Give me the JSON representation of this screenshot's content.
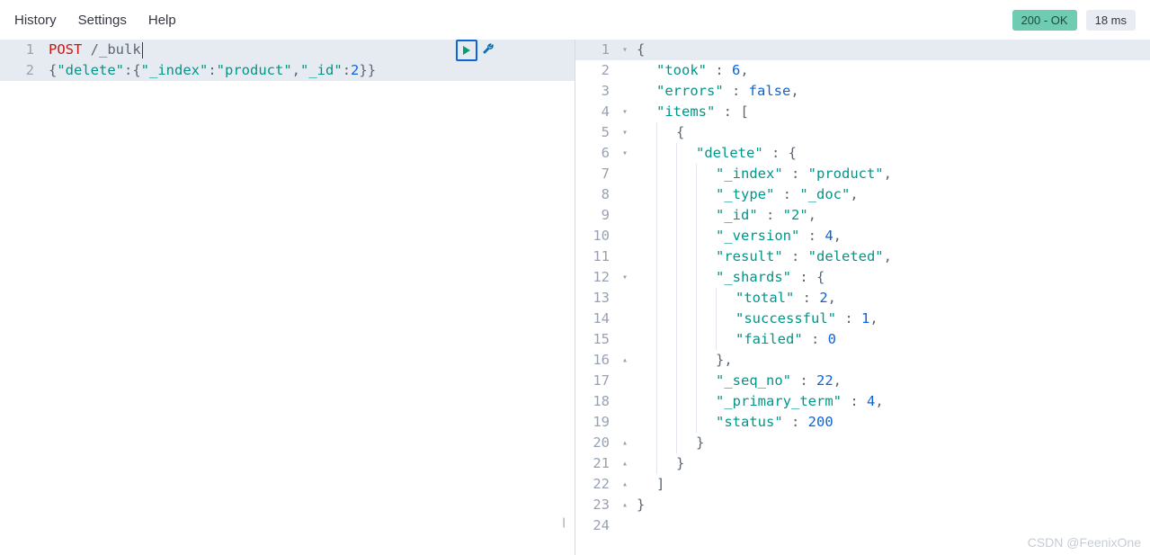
{
  "topbar": {
    "history": "History",
    "settings": "Settings",
    "help": "Help",
    "status_badge": "200 - OK",
    "time_badge": "18 ms"
  },
  "request": {
    "lines": [
      {
        "n": "1",
        "active": true,
        "tokens": [
          {
            "t": "POST",
            "c": "tok-method"
          },
          {
            "t": " ",
            "c": ""
          },
          {
            "t": "/_bulk",
            "c": "tok-path"
          }
        ]
      },
      {
        "n": "2",
        "active": true,
        "tokens": [
          {
            "t": "{",
            "c": "tok-punct"
          },
          {
            "t": "\"delete\"",
            "c": "tok-key"
          },
          {
            "t": ":{",
            "c": "tok-punct"
          },
          {
            "t": "\"_index\"",
            "c": "tok-key"
          },
          {
            "t": ":",
            "c": "tok-punct"
          },
          {
            "t": "\"product\"",
            "c": "tok-str"
          },
          {
            "t": ",",
            "c": "tok-punct"
          },
          {
            "t": "\"_id\"",
            "c": "tok-key"
          },
          {
            "t": ":",
            "c": "tok-punct"
          },
          {
            "t": "2",
            "c": "tok-num"
          },
          {
            "t": "}}",
            "c": "tok-punct"
          }
        ]
      }
    ]
  },
  "response": {
    "lines": [
      {
        "n": "1",
        "fold": "▾",
        "indent": 0,
        "tokens": [
          {
            "t": "{",
            "c": "tok-punct"
          }
        ]
      },
      {
        "n": "2",
        "fold": "",
        "indent": 1,
        "tokens": [
          {
            "t": "\"took\"",
            "c": "tok-key"
          },
          {
            "t": " : ",
            "c": "tok-punct"
          },
          {
            "t": "6",
            "c": "tok-num"
          },
          {
            "t": ",",
            "c": "tok-punct"
          }
        ]
      },
      {
        "n": "3",
        "fold": "",
        "indent": 1,
        "tokens": [
          {
            "t": "\"errors\"",
            "c": "tok-key"
          },
          {
            "t": " : ",
            "c": "tok-punct"
          },
          {
            "t": "false",
            "c": "tok-bool"
          },
          {
            "t": ",",
            "c": "tok-punct"
          }
        ]
      },
      {
        "n": "4",
        "fold": "▾",
        "indent": 1,
        "tokens": [
          {
            "t": "\"items\"",
            "c": "tok-key"
          },
          {
            "t": " : [",
            "c": "tok-punct"
          }
        ]
      },
      {
        "n": "5",
        "fold": "▾",
        "indent": 2,
        "tokens": [
          {
            "t": "{",
            "c": "tok-punct"
          }
        ]
      },
      {
        "n": "6",
        "fold": "▾",
        "indent": 3,
        "tokens": [
          {
            "t": "\"delete\"",
            "c": "tok-key"
          },
          {
            "t": " : {",
            "c": "tok-punct"
          }
        ]
      },
      {
        "n": "7",
        "fold": "",
        "indent": 4,
        "tokens": [
          {
            "t": "\"_index\"",
            "c": "tok-key"
          },
          {
            "t": " : ",
            "c": "tok-punct"
          },
          {
            "t": "\"product\"",
            "c": "tok-str"
          },
          {
            "t": ",",
            "c": "tok-punct"
          }
        ]
      },
      {
        "n": "8",
        "fold": "",
        "indent": 4,
        "tokens": [
          {
            "t": "\"_type\"",
            "c": "tok-key"
          },
          {
            "t": " : ",
            "c": "tok-punct"
          },
          {
            "t": "\"_doc\"",
            "c": "tok-str"
          },
          {
            "t": ",",
            "c": "tok-punct"
          }
        ]
      },
      {
        "n": "9",
        "fold": "",
        "indent": 4,
        "tokens": [
          {
            "t": "\"_id\"",
            "c": "tok-key"
          },
          {
            "t": " : ",
            "c": "tok-punct"
          },
          {
            "t": "\"2\"",
            "c": "tok-str"
          },
          {
            "t": ",",
            "c": "tok-punct"
          }
        ]
      },
      {
        "n": "10",
        "fold": "",
        "indent": 4,
        "tokens": [
          {
            "t": "\"_version\"",
            "c": "tok-key"
          },
          {
            "t": " : ",
            "c": "tok-punct"
          },
          {
            "t": "4",
            "c": "tok-num"
          },
          {
            "t": ",",
            "c": "tok-punct"
          }
        ]
      },
      {
        "n": "11",
        "fold": "",
        "indent": 4,
        "tokens": [
          {
            "t": "\"result\"",
            "c": "tok-key"
          },
          {
            "t": " : ",
            "c": "tok-punct"
          },
          {
            "t": "\"deleted\"",
            "c": "tok-str"
          },
          {
            "t": ",",
            "c": "tok-punct"
          }
        ]
      },
      {
        "n": "12",
        "fold": "▾",
        "indent": 4,
        "tokens": [
          {
            "t": "\"_shards\"",
            "c": "tok-key"
          },
          {
            "t": " : {",
            "c": "tok-punct"
          }
        ]
      },
      {
        "n": "13",
        "fold": "",
        "indent": 5,
        "tokens": [
          {
            "t": "\"total\"",
            "c": "tok-key"
          },
          {
            "t": " : ",
            "c": "tok-punct"
          },
          {
            "t": "2",
            "c": "tok-num"
          },
          {
            "t": ",",
            "c": "tok-punct"
          }
        ]
      },
      {
        "n": "14",
        "fold": "",
        "indent": 5,
        "tokens": [
          {
            "t": "\"successful\"",
            "c": "tok-key"
          },
          {
            "t": " : ",
            "c": "tok-punct"
          },
          {
            "t": "1",
            "c": "tok-num"
          },
          {
            "t": ",",
            "c": "tok-punct"
          }
        ]
      },
      {
        "n": "15",
        "fold": "",
        "indent": 5,
        "tokens": [
          {
            "t": "\"failed\"",
            "c": "tok-key"
          },
          {
            "t": " : ",
            "c": "tok-punct"
          },
          {
            "t": "0",
            "c": "tok-num"
          }
        ]
      },
      {
        "n": "16",
        "fold": "▴",
        "indent": 4,
        "tokens": [
          {
            "t": "},",
            "c": "tok-punct"
          }
        ]
      },
      {
        "n": "17",
        "fold": "",
        "indent": 4,
        "tokens": [
          {
            "t": "\"_seq_no\"",
            "c": "tok-key"
          },
          {
            "t": " : ",
            "c": "tok-punct"
          },
          {
            "t": "22",
            "c": "tok-num"
          },
          {
            "t": ",",
            "c": "tok-punct"
          }
        ]
      },
      {
        "n": "18",
        "fold": "",
        "indent": 4,
        "tokens": [
          {
            "t": "\"_primary_term\"",
            "c": "tok-key"
          },
          {
            "t": " : ",
            "c": "tok-punct"
          },
          {
            "t": "4",
            "c": "tok-num"
          },
          {
            "t": ",",
            "c": "tok-punct"
          }
        ]
      },
      {
        "n": "19",
        "fold": "",
        "indent": 4,
        "tokens": [
          {
            "t": "\"status\"",
            "c": "tok-key"
          },
          {
            "t": " : ",
            "c": "tok-punct"
          },
          {
            "t": "200",
            "c": "tok-num"
          }
        ]
      },
      {
        "n": "20",
        "fold": "▴",
        "indent": 3,
        "tokens": [
          {
            "t": "}",
            "c": "tok-punct"
          }
        ]
      },
      {
        "n": "21",
        "fold": "▴",
        "indent": 2,
        "tokens": [
          {
            "t": "}",
            "c": "tok-punct"
          }
        ]
      },
      {
        "n": "22",
        "fold": "▴",
        "indent": 1,
        "tokens": [
          {
            "t": "]",
            "c": "tok-punct"
          }
        ]
      },
      {
        "n": "23",
        "fold": "▴",
        "indent": 0,
        "tokens": [
          {
            "t": "}",
            "c": "tok-punct"
          }
        ]
      },
      {
        "n": "24",
        "fold": "",
        "indent": 0,
        "tokens": []
      }
    ]
  },
  "watermark": "CSDN @FeenixOne"
}
